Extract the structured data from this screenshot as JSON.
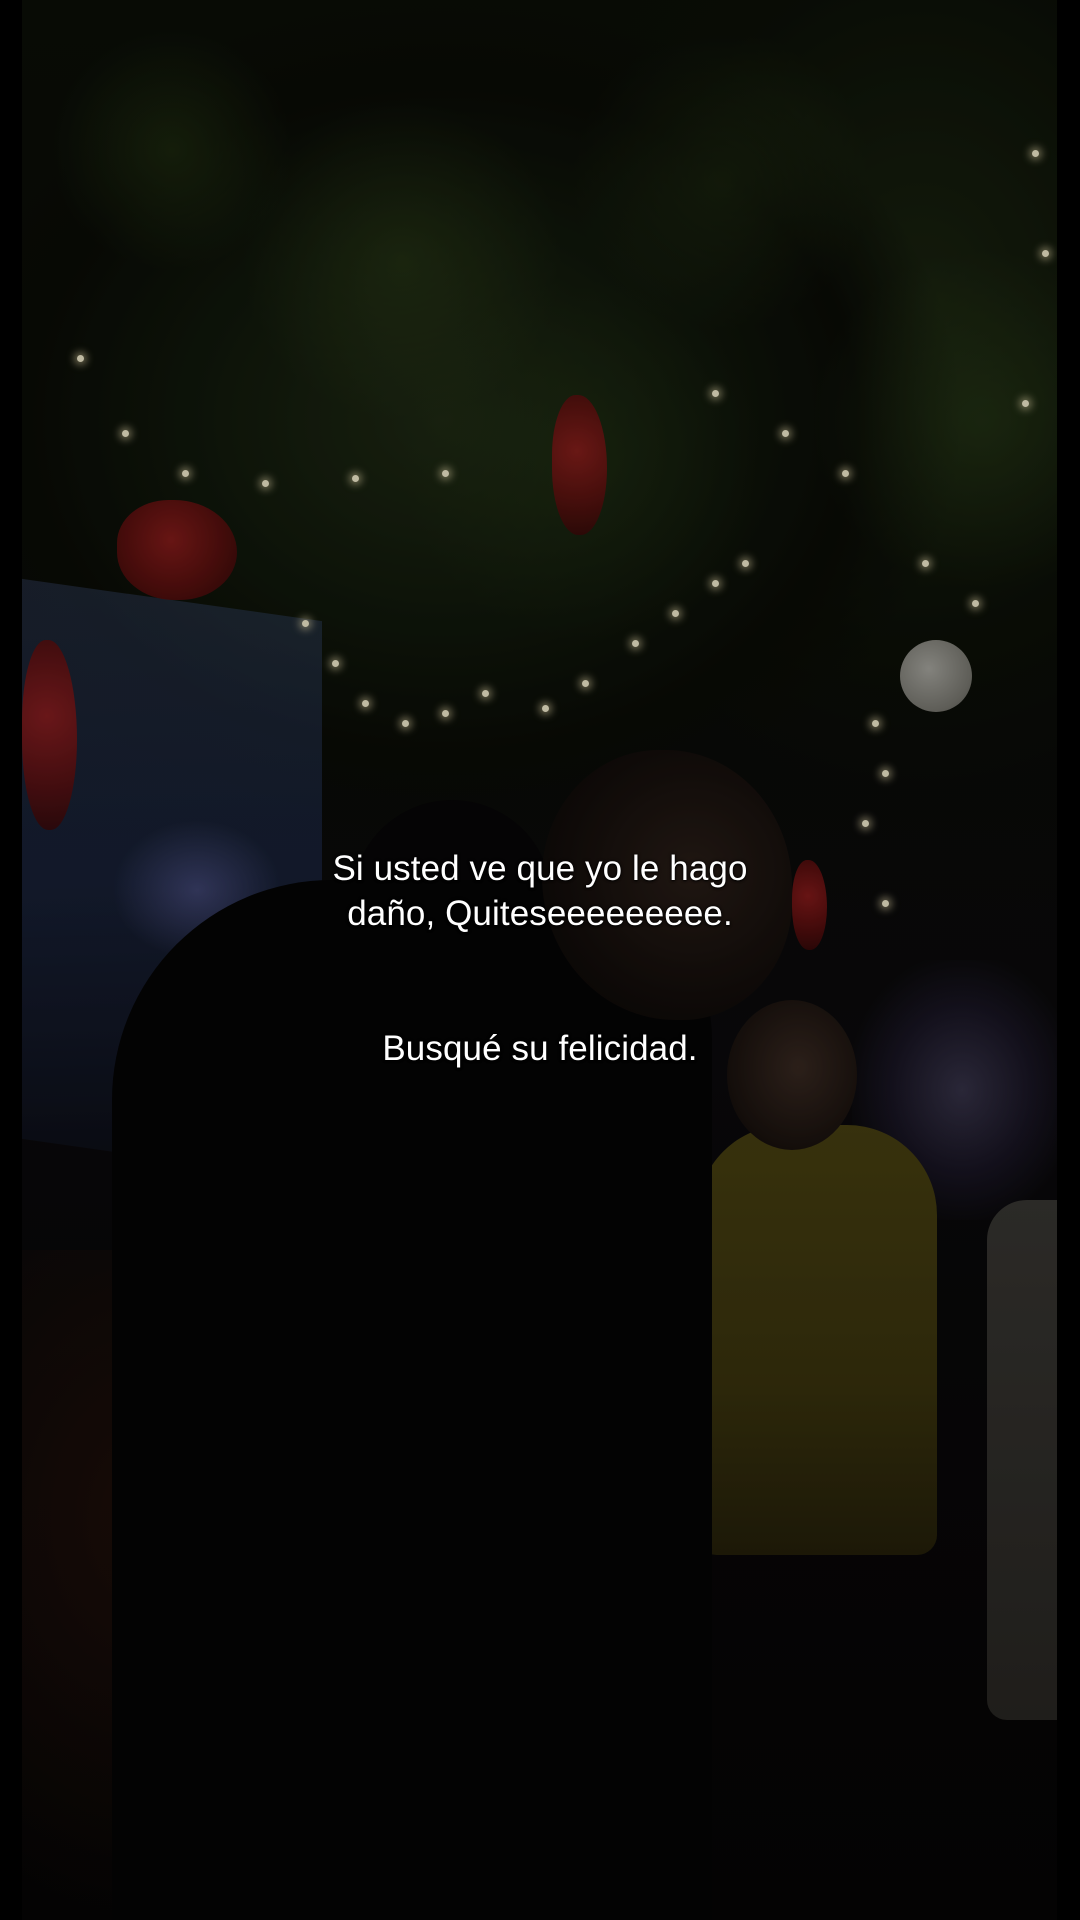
{
  "captions": {
    "first": {
      "line1": "Si usted ve que yo le hago",
      "line2": "daño, Quiteseeeeeeeee."
    },
    "second": {
      "line1": "Busqué su felicidad."
    }
  },
  "colors": {
    "background": "#000000",
    "caption_text": "#ffffff"
  }
}
